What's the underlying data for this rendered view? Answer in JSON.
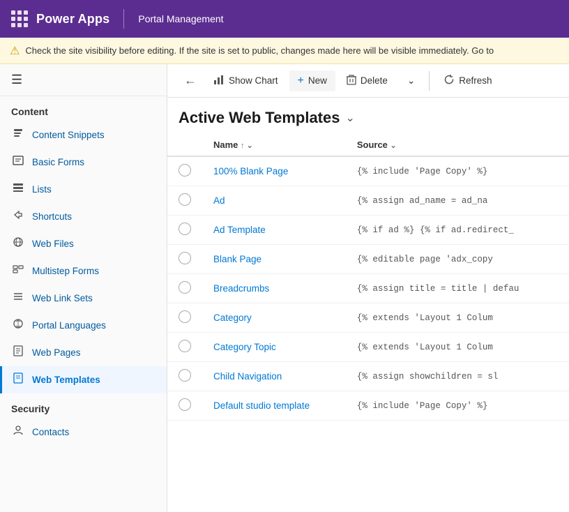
{
  "topbar": {
    "app_name": "Power Apps",
    "divider": true,
    "section_name": "Portal Management",
    "dots_count": 9
  },
  "warning": {
    "text": "Check the site visibility before editing. If the site is set to public, changes made here will be visible immediately. Go to"
  },
  "toolbar": {
    "back_label": "←",
    "show_chart_label": "Show Chart",
    "new_label": "New",
    "delete_label": "Delete",
    "chevron_down_label": "⌄",
    "refresh_label": "Refresh"
  },
  "table_title": "Active Web Templates",
  "columns": [
    {
      "label": "Name",
      "sort": "↑ ⌄"
    },
    {
      "label": "Source",
      "sort": "⌄"
    }
  ],
  "rows": [
    {
      "name": "100% Blank Page",
      "source": "{% include 'Page Copy' %}"
    },
    {
      "name": "Ad",
      "source": "{% assign ad_name = ad_na"
    },
    {
      "name": "Ad Template",
      "source": "{% if ad %} {% if ad.redirect_"
    },
    {
      "name": "Blank Page",
      "source": "{% editable page 'adx_copy"
    },
    {
      "name": "Breadcrumbs",
      "source": "{% assign title = title | defau"
    },
    {
      "name": "Category",
      "source": "{% extends 'Layout 1 Colum"
    },
    {
      "name": "Category Topic",
      "source": "{% extends 'Layout 1 Colum"
    },
    {
      "name": "Child Navigation",
      "source": "{% assign showchildren = sl"
    },
    {
      "name": "Default studio template",
      "source": "{% include 'Page Copy' %}"
    }
  ],
  "sidebar": {
    "content_title": "Content",
    "items": [
      {
        "id": "content-snippets",
        "label": "Content Snippets",
        "icon": "📄"
      },
      {
        "id": "basic-forms",
        "label": "Basic Forms",
        "icon": "📋"
      },
      {
        "id": "lists",
        "label": "Lists",
        "icon": "📑"
      },
      {
        "id": "shortcuts",
        "label": "Shortcuts",
        "icon": "🔗"
      },
      {
        "id": "web-files",
        "label": "Web Files",
        "icon": "🌐"
      },
      {
        "id": "multistep-forms",
        "label": "Multistep Forms",
        "icon": "📝"
      },
      {
        "id": "web-link-sets",
        "label": "Web Link Sets",
        "icon": "≡"
      },
      {
        "id": "portal-languages",
        "label": "Portal Languages",
        "icon": "🌍"
      },
      {
        "id": "web-pages",
        "label": "Web Pages",
        "icon": "📄"
      },
      {
        "id": "web-templates",
        "label": "Web Templates",
        "icon": "📄",
        "active": true
      }
    ],
    "security_title": "Security",
    "security_items": [
      {
        "id": "contacts",
        "label": "Contacts",
        "icon": "👤"
      }
    ]
  }
}
